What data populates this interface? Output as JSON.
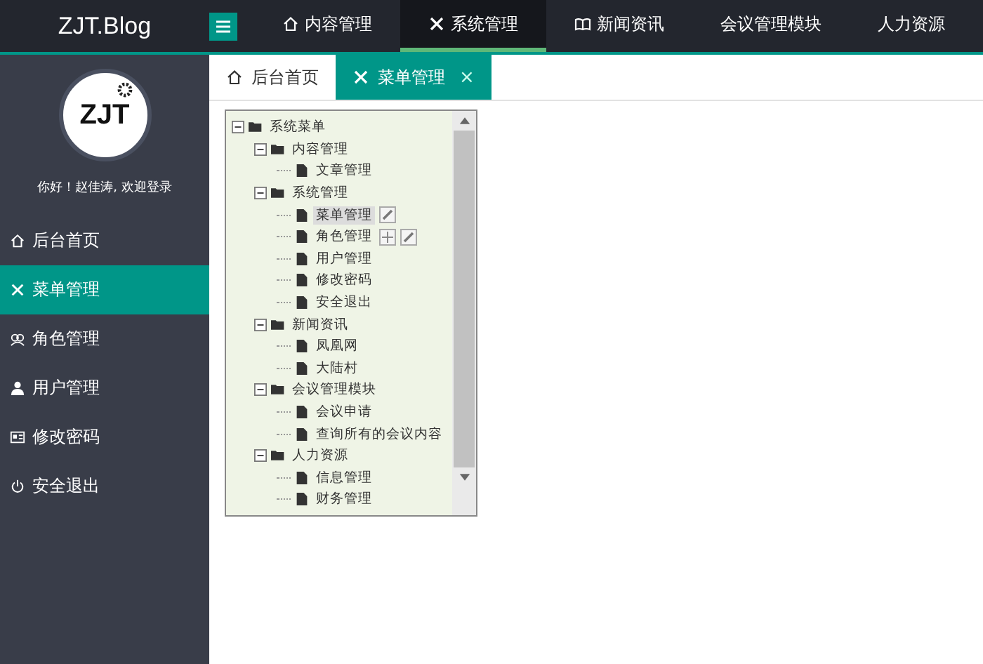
{
  "header": {
    "logo": "ZJT.Blog",
    "nav": [
      {
        "label": "内容管理",
        "selected": false
      },
      {
        "label": "系统管理",
        "selected": true
      },
      {
        "label": "新闻资讯",
        "selected": false
      },
      {
        "label": "会议管理模块",
        "selected": false
      },
      {
        "label": "人力资源",
        "selected": false
      }
    ]
  },
  "sidebar": {
    "avatar_logo": "ZJT",
    "greeting": "你好！赵佳涛, 欢迎登录",
    "items": [
      {
        "label": "后台首页",
        "selected": false
      },
      {
        "label": "菜单管理",
        "selected": true
      },
      {
        "label": "角色管理",
        "selected": false
      },
      {
        "label": "用户管理",
        "selected": false
      },
      {
        "label": "修改密码",
        "selected": false
      },
      {
        "label": "安全退出",
        "selected": false
      }
    ]
  },
  "tabs": [
    {
      "label": "后台首页",
      "selected": false
    },
    {
      "label": "菜单管理",
      "selected": true,
      "close": "×"
    }
  ],
  "tree": {
    "nodes": [
      {
        "label": "系统菜单",
        "expanded": true,
        "children": [
          {
            "label": "内容管理",
            "expanded": true,
            "children": [
              {
                "label": "文章管理"
              }
            ]
          },
          {
            "label": "系统管理",
            "expanded": true,
            "children": [
              {
                "label": "菜单管理",
                "highlighted": true,
                "actions": [
                  {
                    "kind": "edit"
                  }
                ]
              },
              {
                "label": "角色管理",
                "highlighted": false,
                "actions": [
                  {
                    "kind": "add"
                  },
                  {
                    "kind": "edit"
                  }
                ]
              },
              {
                "label": "用户管理"
              },
              {
                "label": "修改密码"
              },
              {
                "label": "安全退出"
              }
            ]
          },
          {
            "label": "新闻资讯",
            "expanded": true,
            "children": [
              {
                "label": "凤凰网"
              },
              {
                "label": "大陆村"
              }
            ]
          },
          {
            "label": "会议管理模块",
            "expanded": true,
            "children": [
              {
                "label": "会议申请"
              },
              {
                "label": "查询所有的会议内容"
              }
            ]
          },
          {
            "label": "人力资源",
            "expanded": true,
            "children": [
              {
                "label": "信息管理"
              },
              {
                "label": "财务管理"
              }
            ]
          }
        ]
      }
    ]
  }
}
